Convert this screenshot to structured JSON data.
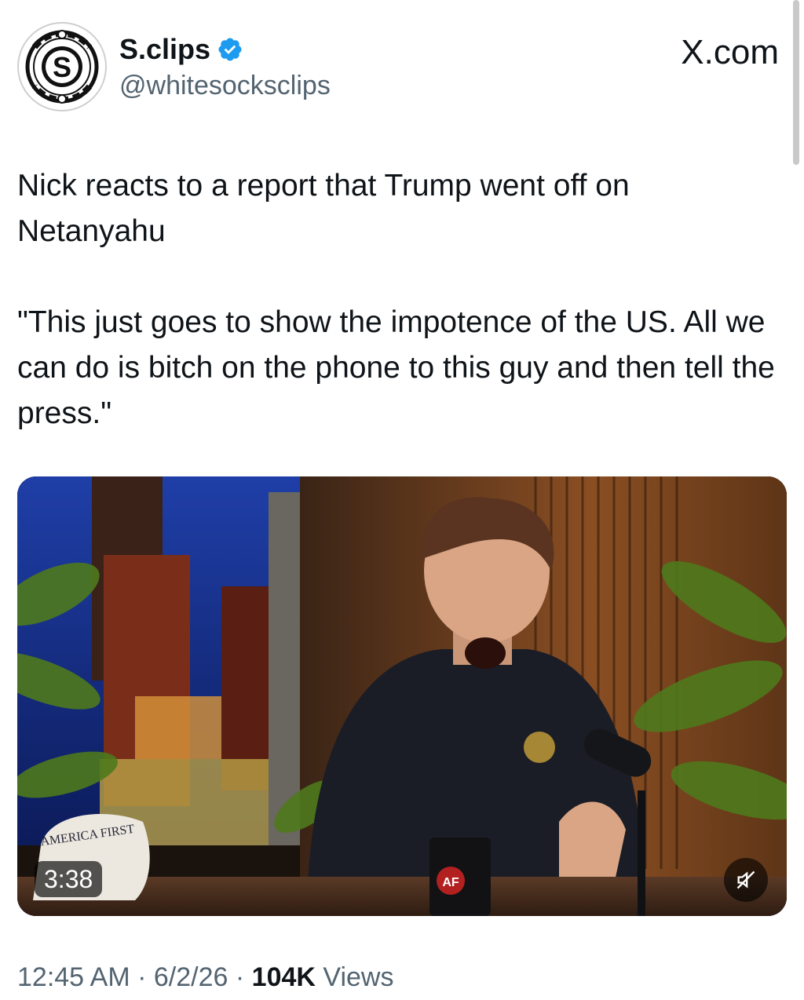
{
  "author": {
    "name": "S.clips",
    "handle": "@whitesocksclips",
    "verified": true,
    "avatar_letter": "S"
  },
  "source_label": "X.com",
  "post": {
    "text": "Nick reacts to a report that Trump went off on Netanyahu\n\n\"This just goes to show the impotence of the US. All we can do is bitch on the phone to this guy and then tell the press.\""
  },
  "video": {
    "duration": "3:38",
    "hat_text": "AMERICA FIRST",
    "mug_text": "AF",
    "muted": true
  },
  "footer": {
    "time": "12:45 AM",
    "date": "6/2/26",
    "views_count": "104K",
    "views_label": "Views",
    "separator": "·"
  },
  "colors": {
    "text_primary": "#0f1419",
    "text_secondary": "#536471",
    "verified_blue": "#1d9bf0"
  }
}
